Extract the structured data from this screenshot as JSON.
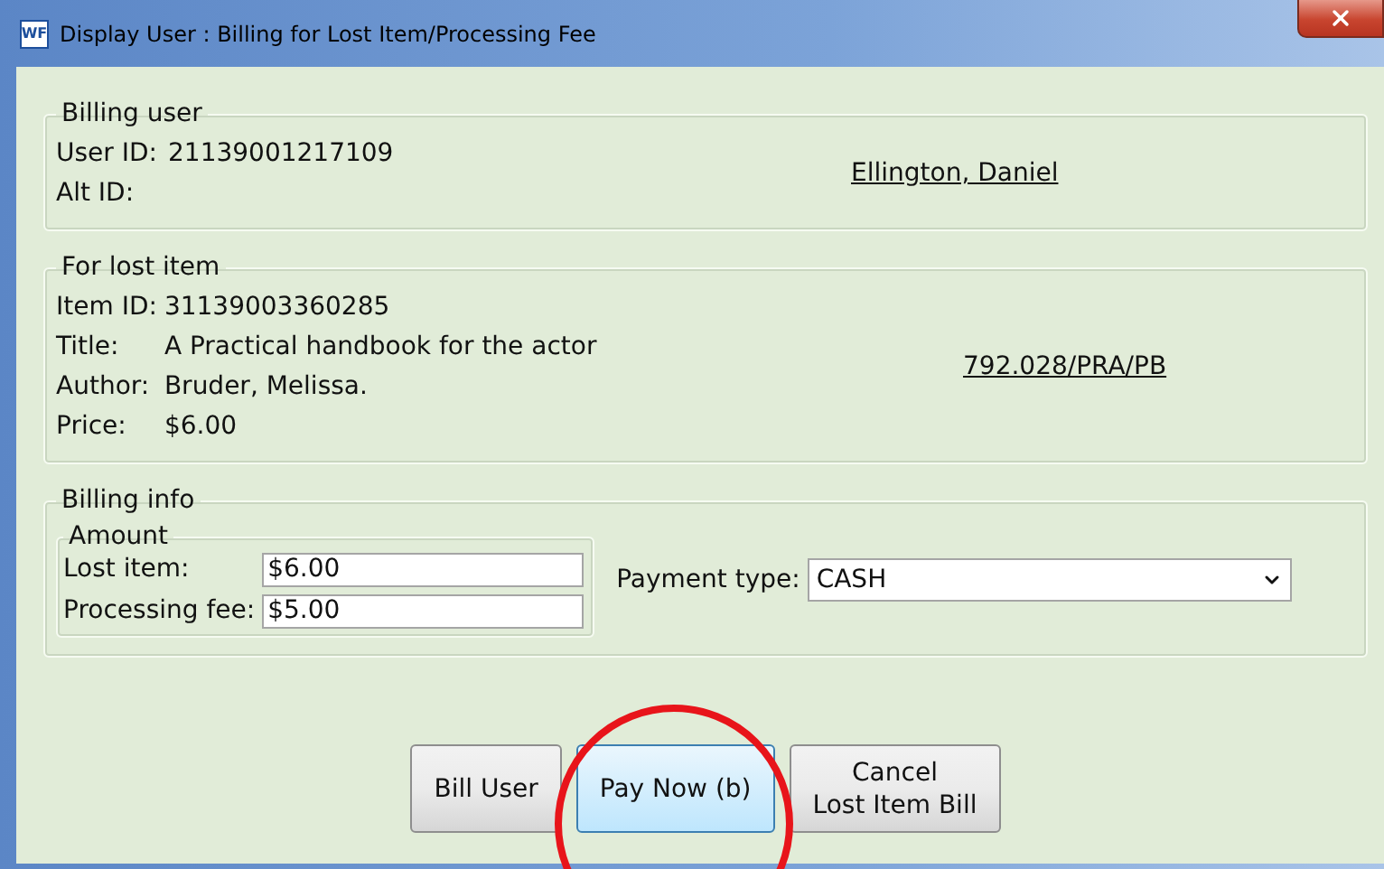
{
  "window": {
    "title": "Display User : Billing for Lost Item/Processing Fee",
    "icon_text": "WF"
  },
  "billing_user": {
    "legend": "Billing user",
    "fields": [
      {
        "label": "User ID:",
        "value": "21139001217109"
      },
      {
        "label": "Alt ID:"
      }
    ],
    "user_name": "Ellington, Daniel"
  },
  "lost_item": {
    "legend": "For lost item",
    "fields": [
      {
        "label": "Item ID:",
        "value": "31139003360285"
      },
      {
        "label": "Title:",
        "value": "A Practical handbook for the actor"
      },
      {
        "label": "Author:",
        "value": "Bruder, Melissa."
      },
      {
        "label": "Price:",
        "value": "$6.00"
      }
    ],
    "call_number": "792.028/PRA/PB"
  },
  "billing_info": {
    "legend": "Billing info",
    "amount": {
      "legend": "Amount",
      "fields": [
        {
          "label": "Lost item:",
          "value": "$6.00"
        },
        {
          "label": "Processing fee:",
          "value": "$5.00"
        }
      ]
    },
    "payment_type": {
      "label": "Payment type:",
      "value": "CASH"
    }
  },
  "buttons": [
    {
      "lines": [
        "Bill User"
      ],
      "focused": false
    },
    {
      "lines": [
        "Pay Now (b)"
      ],
      "focused": true
    },
    {
      "lines": [
        "Cancel",
        "Lost Item Bill"
      ],
      "focused": false
    }
  ]
}
